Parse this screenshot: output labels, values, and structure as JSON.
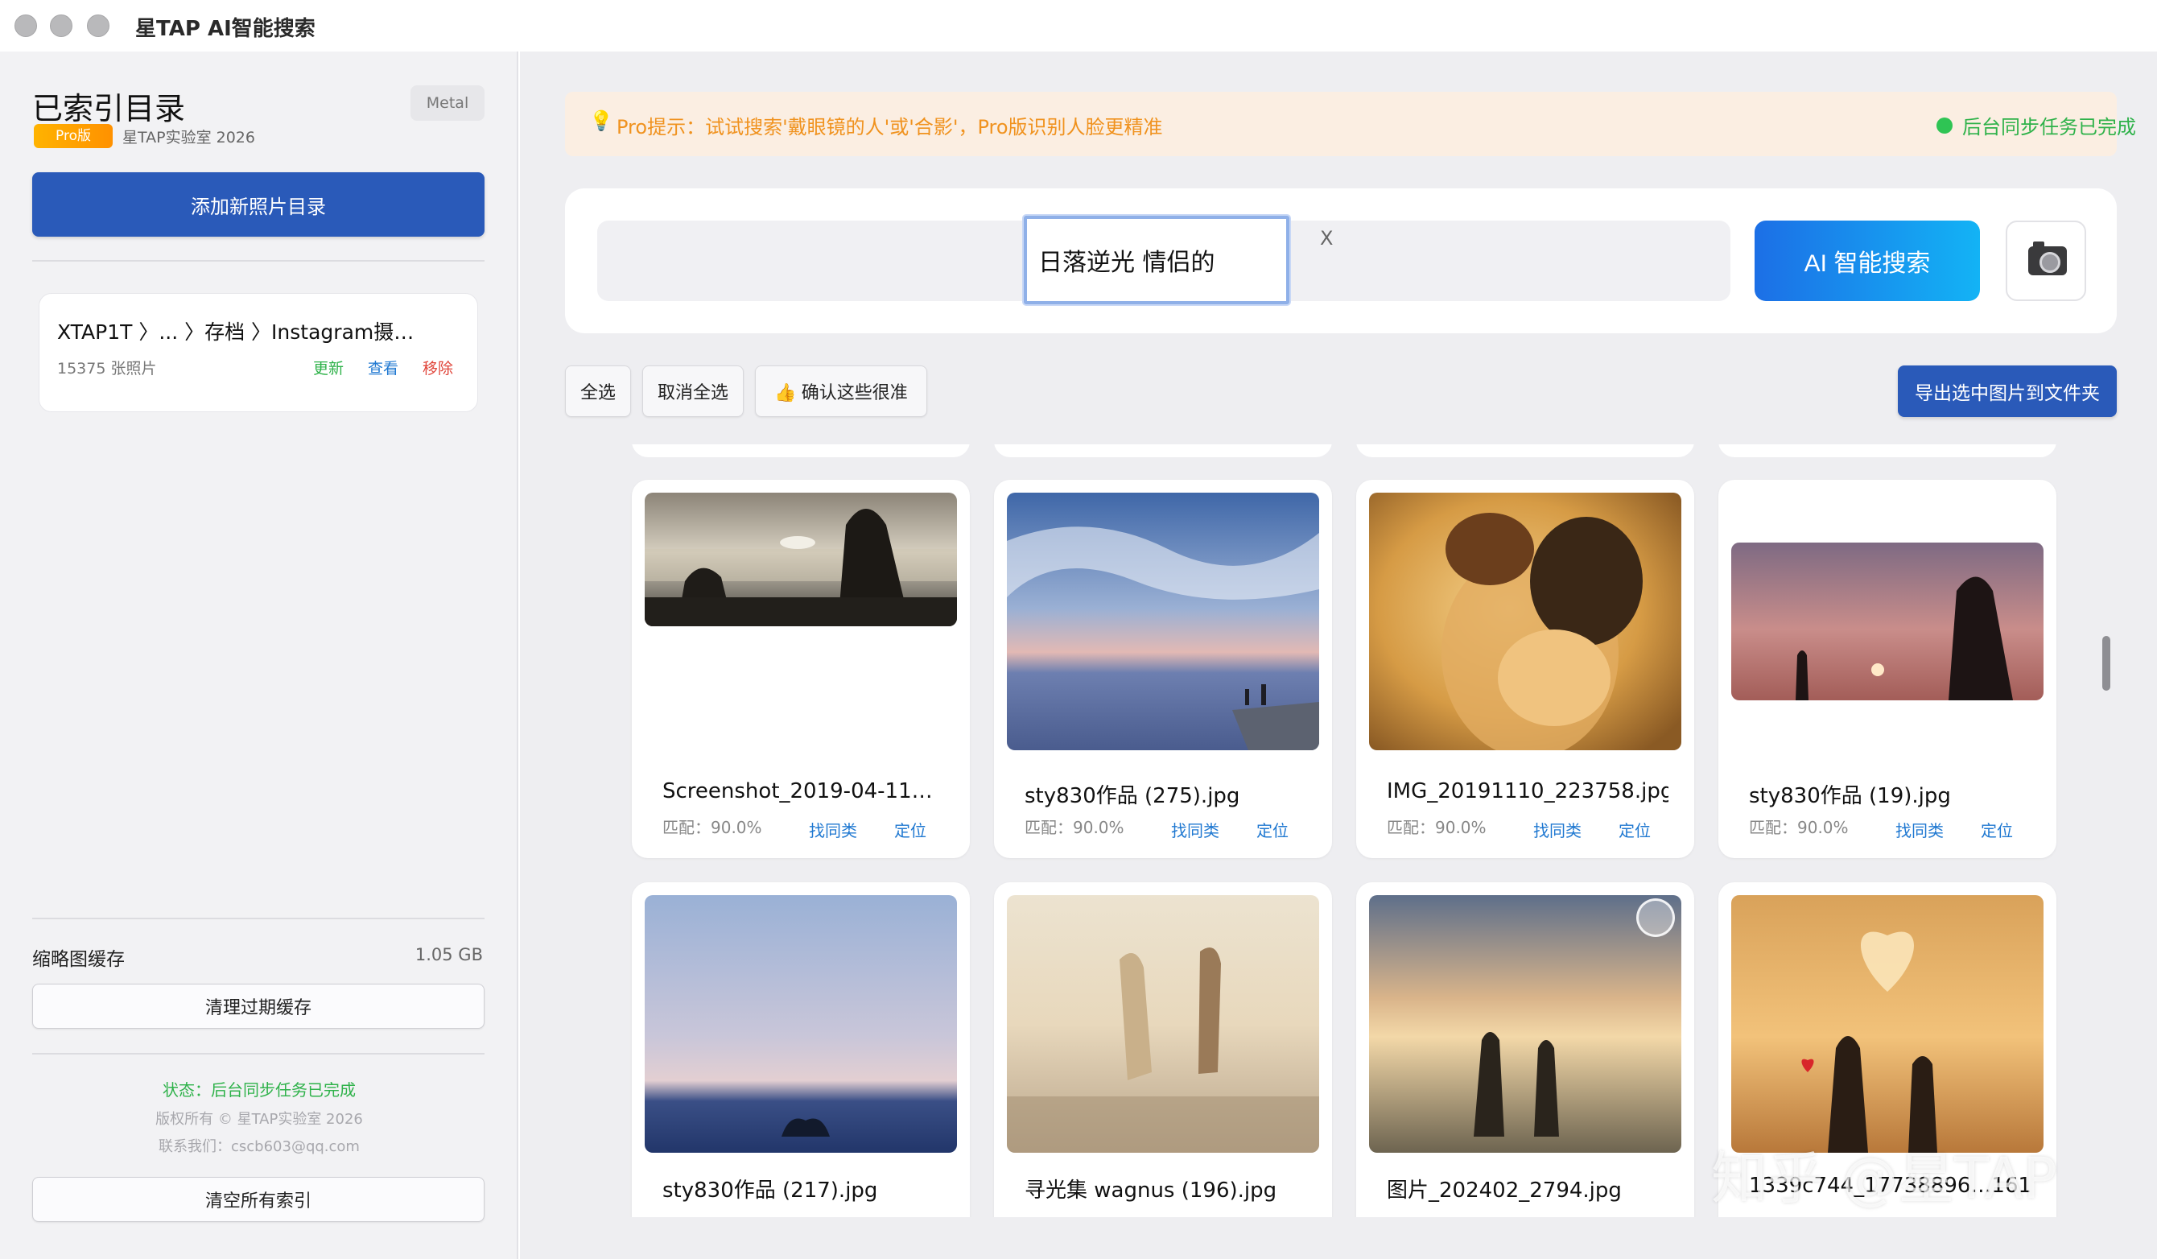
{
  "window": {
    "title": "星TAP AI智能搜索"
  },
  "sidebar": {
    "title": "已索引目录",
    "engine_tag": "Metal",
    "pro_badge": "Pro版",
    "lab_label": "星TAP实验室 2026",
    "add_dir_button": "添加新照片目录",
    "directories": [
      {
        "path": "XTAP1T 〉... 〉存档 〉Instagram摄…",
        "count": "15375 张照片",
        "update": "更新",
        "view": "查看",
        "remove": "移除"
      }
    ],
    "cache": {
      "label": "缩略图缓存",
      "size": "1.05 GB",
      "clear_expired_button": "清理过期缓存"
    },
    "status": "状态：后台同步任务已完成",
    "copyright": "版权所有 © 星TAP实验室 2026",
    "contact": "联系我们：cscb603@qq.com",
    "clear_all_button": "清空所有索引"
  },
  "main": {
    "tip": {
      "text": "Pro提示：试试搜索'戴眼镜的人'或'合影'，Pro版识别人脸更精准",
      "sync_status": "后台同步任务已完成"
    },
    "search": {
      "query": "日落逆光 情侣的",
      "clear": "X",
      "ai_button": "AI 智能搜索"
    },
    "toolbar": {
      "select_all": "全选",
      "deselect_all": "取消全选",
      "confirm_icon": "👍",
      "confirm": "确认这些很准",
      "export": "导出选中图片到文件夹"
    },
    "results": [
      {
        "name": "Screenshot_2019-04-11…",
        "match": "匹配：90.0%",
        "similar": "找同类",
        "locate": "定位"
      },
      {
        "name": "sty830作品 (275).jpg",
        "match": "匹配：90.0%",
        "similar": "找同类",
        "locate": "定位"
      },
      {
        "name": "IMG_20191110_223758.jpg",
        "match": "匹配：90.0%",
        "similar": "找同类",
        "locate": "定位"
      },
      {
        "name": "sty830作品 (19).jpg",
        "match": "匹配：90.0%",
        "similar": "找同类",
        "locate": "定位"
      },
      {
        "name": "sty830作品 (217).jpg"
      },
      {
        "name": "寻光集 wagnus (196).jpg"
      },
      {
        "name": "图片_202402_2794.jpg"
      },
      {
        "name": "1339c744_17738896…161…"
      }
    ],
    "watermark": "知乎 @星TAP"
  }
}
